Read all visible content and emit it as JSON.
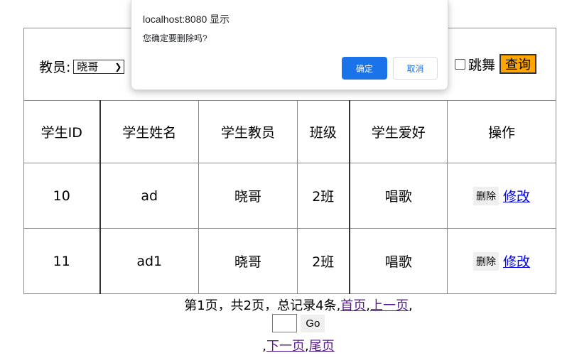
{
  "filter": {
    "teacher_label": "教员:",
    "teacher_selected": "晓哥",
    "hobby_dance": "跳舞",
    "query_button": "查询"
  },
  "table": {
    "headers": [
      "学生ID",
      "学生姓名",
      "学生教员",
      "班级",
      "学生爱好",
      "操作"
    ],
    "rows": [
      {
        "id": "10",
        "name": "ad",
        "teacher": "晓哥",
        "class": "2班",
        "hobby": "唱歌",
        "delete": "删除",
        "edit": "修改"
      },
      {
        "id": "11",
        "name": "ad1",
        "teacher": "晓哥",
        "class": "2班",
        "hobby": "唱歌",
        "delete": "删除",
        "edit": "修改"
      }
    ]
  },
  "pagination": {
    "summary": "第1页，共2页，总记录4条,",
    "first": "首页",
    "sep1": ",",
    "prev": "上一页",
    "sep2": ",",
    "go_button": "Go",
    "sep3": ",",
    "next": "下一页",
    "sep4": ",",
    "last": "尾页"
  },
  "dialog": {
    "title": "localhost:8080 显示",
    "message": "您确定要删除吗?",
    "ok": "确定",
    "cancel": "取消"
  },
  "colors": {
    "query_button_bg": "#ffa500",
    "dialog_ok_bg": "#1a73e8",
    "link": "#0000ee",
    "visited_link": "#551a8b"
  }
}
